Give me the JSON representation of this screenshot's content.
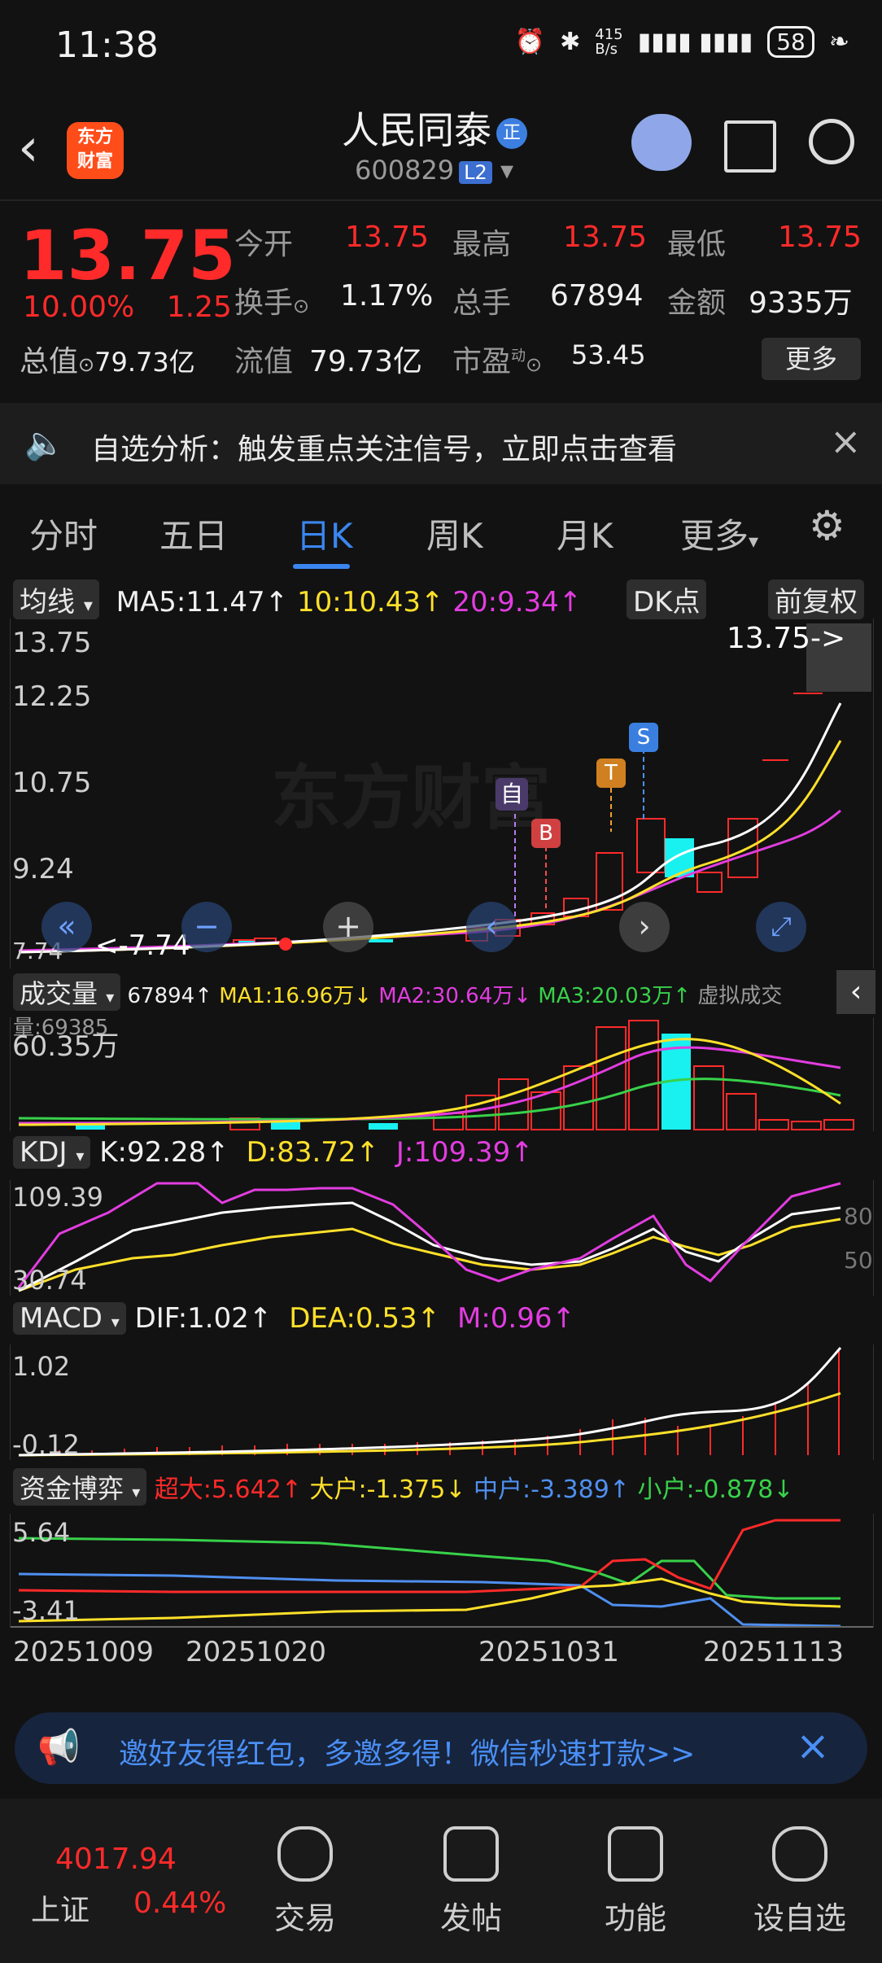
{
  "status_bar": {
    "time": "11:38",
    "net_speed": "415\nB/s",
    "battery": "58"
  },
  "header": {
    "logo_text": "东方\n财富",
    "stock_name": "人民同泰",
    "badge": "正",
    "stock_code": "600829",
    "level": "L2"
  },
  "quote": {
    "price": "13.75",
    "change_pct": "10.00%",
    "change_abs": "1.25",
    "open_label": "今开",
    "open": "13.75",
    "high_label": "最高",
    "high": "13.75",
    "low_label": "最低",
    "low": "13.75",
    "turnover_label": "换手",
    "turnover": "1.17%",
    "volume_label": "总手",
    "volume": "67894",
    "amount_label": "金额",
    "amount": "9335万",
    "mktcap_label": "总值",
    "mktcap": "79.73亿",
    "float_label": "流值",
    "float": "79.73亿",
    "pe_label": "市盈",
    "pe_sup": "动",
    "pe": "53.45",
    "more_button": "更多"
  },
  "notice": {
    "text": "自选分析：触发重点关注信号，立即点击查看"
  },
  "tabs": [
    "分时",
    "五日",
    "日K",
    "周K",
    "月K",
    "更多"
  ],
  "active_tab": "日K",
  "ma_bar": {
    "selector": "均线",
    "ma5": "MA5:11.47↑",
    "ma10": "10:10.43↑",
    "ma20": "20:9.34↑",
    "dk_button": "DK点",
    "fq_button": "前复权"
  },
  "kline": {
    "y_labels": [
      "13.75",
      "12.25",
      "10.75",
      "9.24",
      "7.74"
    ],
    "last_marker": "13.75->",
    "low_marker": "<-7.74",
    "markers": {
      "zi": "自",
      "b": "B",
      "t": "T",
      "s": "S"
    },
    "watermark": "东方财富"
  },
  "vol_bar": {
    "selector": "成交量",
    "vol": "67894↑",
    "ma1": "MA1:16.96万↓",
    "ma2": "MA2:30.64万↓",
    "ma3": "MA3:20.03万↑",
    "virtual": "虚拟成交量:69385"
  },
  "vol_chart": {
    "y_label": "60.35万"
  },
  "kdj_bar": {
    "selector": "KDJ",
    "k": "K:92.28↑",
    "d": "D:83.72↑",
    "j": "J:109.39↑"
  },
  "kdj_chart": {
    "y_top": "109.39",
    "y_bottom": "30.74",
    "r80": "80",
    "r50": "50"
  },
  "macd_bar": {
    "selector": "MACD",
    "dif": "DIF:1.02↑",
    "dea": "DEA:0.53↑",
    "m": "M:0.96↑"
  },
  "macd_chart": {
    "y_top": "1.02",
    "y_bottom": "-0.12"
  },
  "fund_bar": {
    "selector": "资金博弈",
    "super": "超大:5.642↑",
    "large": "大户:-1.375↓",
    "mid": "中户:-3.389↑",
    "small": "小户:-0.878↓"
  },
  "fund_chart": {
    "y_top": "5.64",
    "y_bottom": "-3.41"
  },
  "dates": [
    "20251009",
    "20251020",
    "20251031",
    "20251113"
  ],
  "ad": {
    "text": "邀好友得红包，多邀多得！微信秒速打款>>"
  },
  "bottom_nav": {
    "index_value": "4017.94",
    "index_name": "上证",
    "index_change": "0.44%",
    "items": [
      "交易",
      "发帖",
      "功能",
      "设自选"
    ]
  },
  "colors": {
    "up": "#ff2a2a",
    "accent": "#3a86ef",
    "ma5": "#ffffff",
    "ma10": "#ffe02a",
    "ma20": "#e23de0",
    "cyan": "#19f0f0"
  }
}
